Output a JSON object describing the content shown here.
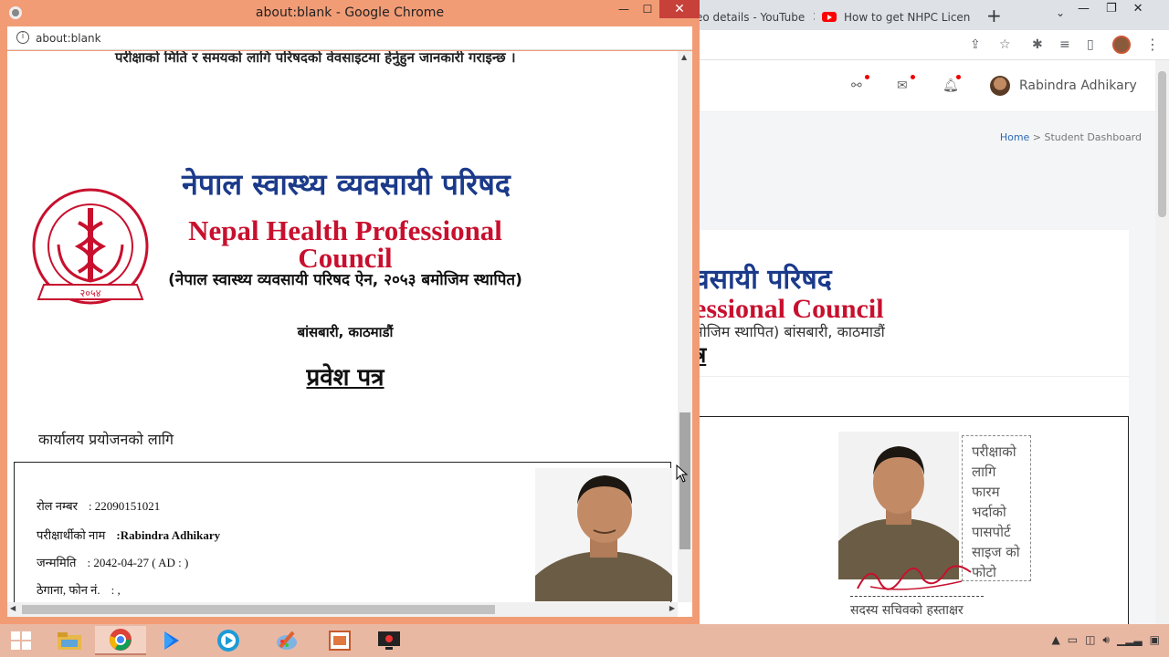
{
  "background_window": {
    "tabs": [
      {
        "label": "eo details - YouTube"
      },
      {
        "label": "How to get NHPC Licen"
      }
    ],
    "new_tab": "+",
    "username": "Rabindra Adhikary",
    "breadcrumb": {
      "home": "Home",
      "separator": " > ",
      "current": "Student Dashboard"
    },
    "title_np": "वसायी परिषद",
    "title_en": "essional Council",
    "established": "मोजिम स्थापित) बांसबारी, काठमाडौं",
    "admit_fragment": "त्र",
    "photo_note": "परीक्षाको लागि फारम भर्दाको पासपोर्ट साइज को फोटो",
    "sign_label": "सदस्य सचिवको हस्ताक्षर"
  },
  "popup": {
    "window_title": "about:blank - Google Chrome",
    "url": "about:blank",
    "doc": {
      "top_line": "परीक्षाको मिति र समयको लागि परिषदको वेवसाइटमा हेर्नुहुन जानकारी गराइन्छ ।",
      "logo_year": "२०५४",
      "council_np": "नेपाल स्वास्थ्य व्यवसायी परिषद",
      "council_en": "Nepal Health Professional Council",
      "established": "(नेपाल स्वास्थ्य व्यवसायी परिषद ऐन, २०५३ बमोजिम स्थापित)",
      "address": "बांसबारी, काठमाडौं",
      "admit_card": "प्रवेश पत्र",
      "office_use": "कार्यालय प्रयोजनको लागि",
      "rows": [
        {
          "label": "रोल नम्बर",
          "value": ": 22090151021"
        },
        {
          "label": "परीक्षार्थीको नाम",
          "value": ":Rabindra Adhikary"
        },
        {
          "label": "जन्ममिति",
          "value": ": 2042-04-27     ( AD : )"
        },
        {
          "label": "ठेगाना, फोन नं.",
          "value": ": ,"
        }
      ]
    }
  },
  "colors": {
    "popup_frame": "#f29c76",
    "close_button": "#c7403a",
    "council_blue": "#1b3a8a",
    "council_red": "#c8102e",
    "taskbar": "#e9b8a3"
  },
  "taskbar": {
    "apps": [
      "file-explorer-icon",
      "chrome-icon",
      "play-store-icon",
      "kinemaster-icon",
      "paint-icon",
      "presentation-icon",
      "screen-recorder-icon"
    ]
  }
}
